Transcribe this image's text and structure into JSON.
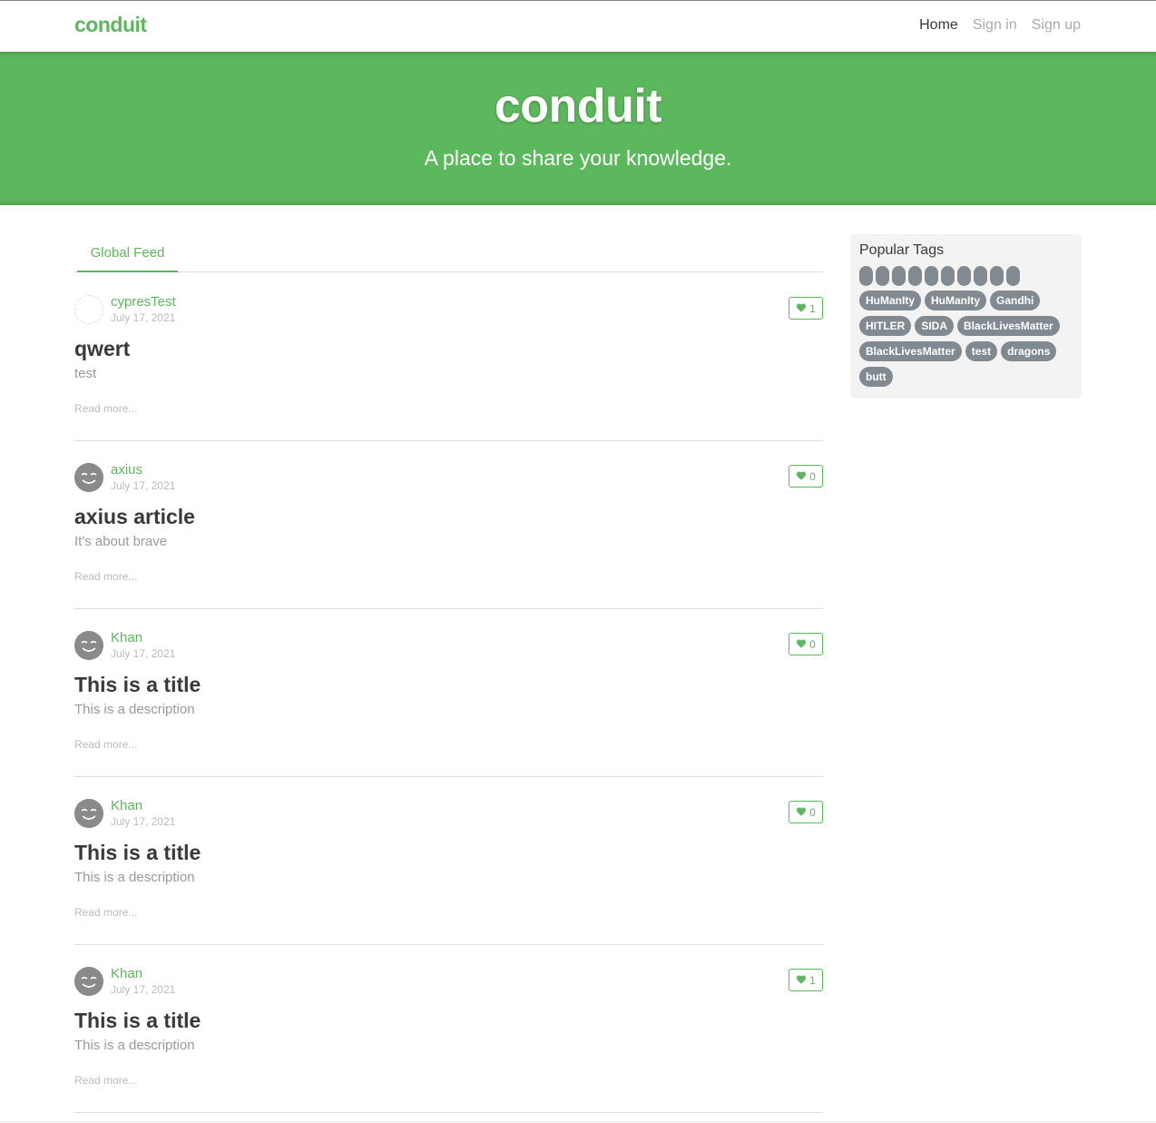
{
  "navbar": {
    "brand": "conduit",
    "links": [
      {
        "label": "Home",
        "active": true
      },
      {
        "label": "Sign in",
        "active": false
      },
      {
        "label": "Sign up",
        "active": false
      }
    ]
  },
  "banner": {
    "title": "conduit",
    "subtitle": "A place to share your knowledge."
  },
  "feed": {
    "tabs": [
      {
        "label": "Global Feed",
        "active": true
      }
    ]
  },
  "articles": [
    {
      "author": "cypresTest",
      "date": "July 17, 2021",
      "favorites": "1",
      "title": "qwert",
      "description": "test",
      "read_more": "Read more...",
      "avatar": "blank-avatar"
    },
    {
      "author": "axius",
      "date": "July 17, 2021",
      "favorites": "0",
      "title": "axius article",
      "description": "It's about brave",
      "read_more": "Read more...",
      "avatar": "smiley-avatar"
    },
    {
      "author": "Khan",
      "date": "July 17, 2021",
      "favorites": "0",
      "title": "This is a title",
      "description": "This is a description",
      "read_more": "Read more...",
      "avatar": "smiley-avatar"
    },
    {
      "author": "Khan",
      "date": "July 17, 2021",
      "favorites": "0",
      "title": "This is a title",
      "description": "This is a description",
      "read_more": "Read more...",
      "avatar": "smiley-avatar"
    },
    {
      "author": "Khan",
      "date": "July 17, 2021",
      "favorites": "1",
      "title": "This is a title",
      "description": "This is a description",
      "read_more": "Read more...",
      "avatar": "smiley-avatar"
    }
  ],
  "sidebar": {
    "title": "Popular Tags",
    "empty_tag_count": 10,
    "tags": [
      "HuManIty",
      "HuManIty",
      "Gandhi",
      "HITLER",
      "SIDA",
      "BlackLivesMatter",
      "BlackLivesMatter",
      "test",
      "dragons",
      "butt"
    ]
  },
  "colors": {
    "brand": "#5cb85c",
    "tag_bg": "#818a91",
    "sidebar_bg": "#f3f3f3"
  },
  "icons": {
    "favorite": "heart-icon"
  }
}
